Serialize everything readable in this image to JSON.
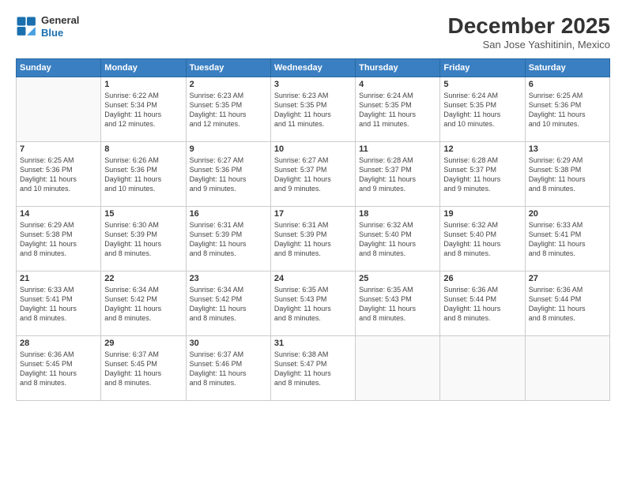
{
  "logo": {
    "line1": "General",
    "line2": "Blue"
  },
  "title": "December 2025",
  "subtitle": "San Jose Yashitinin, Mexico",
  "weekdays": [
    "Sunday",
    "Monday",
    "Tuesday",
    "Wednesday",
    "Thursday",
    "Friday",
    "Saturday"
  ],
  "weeks": [
    [
      {
        "day": "",
        "info": ""
      },
      {
        "day": "1",
        "info": "Sunrise: 6:22 AM\nSunset: 5:34 PM\nDaylight: 11 hours\nand 12 minutes."
      },
      {
        "day": "2",
        "info": "Sunrise: 6:23 AM\nSunset: 5:35 PM\nDaylight: 11 hours\nand 12 minutes."
      },
      {
        "day": "3",
        "info": "Sunrise: 6:23 AM\nSunset: 5:35 PM\nDaylight: 11 hours\nand 11 minutes."
      },
      {
        "day": "4",
        "info": "Sunrise: 6:24 AM\nSunset: 5:35 PM\nDaylight: 11 hours\nand 11 minutes."
      },
      {
        "day": "5",
        "info": "Sunrise: 6:24 AM\nSunset: 5:35 PM\nDaylight: 11 hours\nand 10 minutes."
      },
      {
        "day": "6",
        "info": "Sunrise: 6:25 AM\nSunset: 5:36 PM\nDaylight: 11 hours\nand 10 minutes."
      }
    ],
    [
      {
        "day": "7",
        "info": "Sunrise: 6:25 AM\nSunset: 5:36 PM\nDaylight: 11 hours\nand 10 minutes."
      },
      {
        "day": "8",
        "info": "Sunrise: 6:26 AM\nSunset: 5:36 PM\nDaylight: 11 hours\nand 10 minutes."
      },
      {
        "day": "9",
        "info": "Sunrise: 6:27 AM\nSunset: 5:36 PM\nDaylight: 11 hours\nand 9 minutes."
      },
      {
        "day": "10",
        "info": "Sunrise: 6:27 AM\nSunset: 5:37 PM\nDaylight: 11 hours\nand 9 minutes."
      },
      {
        "day": "11",
        "info": "Sunrise: 6:28 AM\nSunset: 5:37 PM\nDaylight: 11 hours\nand 9 minutes."
      },
      {
        "day": "12",
        "info": "Sunrise: 6:28 AM\nSunset: 5:37 PM\nDaylight: 11 hours\nand 9 minutes."
      },
      {
        "day": "13",
        "info": "Sunrise: 6:29 AM\nSunset: 5:38 PM\nDaylight: 11 hours\nand 8 minutes."
      }
    ],
    [
      {
        "day": "14",
        "info": "Sunrise: 6:29 AM\nSunset: 5:38 PM\nDaylight: 11 hours\nand 8 minutes."
      },
      {
        "day": "15",
        "info": "Sunrise: 6:30 AM\nSunset: 5:39 PM\nDaylight: 11 hours\nand 8 minutes."
      },
      {
        "day": "16",
        "info": "Sunrise: 6:31 AM\nSunset: 5:39 PM\nDaylight: 11 hours\nand 8 minutes."
      },
      {
        "day": "17",
        "info": "Sunrise: 6:31 AM\nSunset: 5:39 PM\nDaylight: 11 hours\nand 8 minutes."
      },
      {
        "day": "18",
        "info": "Sunrise: 6:32 AM\nSunset: 5:40 PM\nDaylight: 11 hours\nand 8 minutes."
      },
      {
        "day": "19",
        "info": "Sunrise: 6:32 AM\nSunset: 5:40 PM\nDaylight: 11 hours\nand 8 minutes."
      },
      {
        "day": "20",
        "info": "Sunrise: 6:33 AM\nSunset: 5:41 PM\nDaylight: 11 hours\nand 8 minutes."
      }
    ],
    [
      {
        "day": "21",
        "info": "Sunrise: 6:33 AM\nSunset: 5:41 PM\nDaylight: 11 hours\nand 8 minutes."
      },
      {
        "day": "22",
        "info": "Sunrise: 6:34 AM\nSunset: 5:42 PM\nDaylight: 11 hours\nand 8 minutes."
      },
      {
        "day": "23",
        "info": "Sunrise: 6:34 AM\nSunset: 5:42 PM\nDaylight: 11 hours\nand 8 minutes."
      },
      {
        "day": "24",
        "info": "Sunrise: 6:35 AM\nSunset: 5:43 PM\nDaylight: 11 hours\nand 8 minutes."
      },
      {
        "day": "25",
        "info": "Sunrise: 6:35 AM\nSunset: 5:43 PM\nDaylight: 11 hours\nand 8 minutes."
      },
      {
        "day": "26",
        "info": "Sunrise: 6:36 AM\nSunset: 5:44 PM\nDaylight: 11 hours\nand 8 minutes."
      },
      {
        "day": "27",
        "info": "Sunrise: 6:36 AM\nSunset: 5:44 PM\nDaylight: 11 hours\nand 8 minutes."
      }
    ],
    [
      {
        "day": "28",
        "info": "Sunrise: 6:36 AM\nSunset: 5:45 PM\nDaylight: 11 hours\nand 8 minutes."
      },
      {
        "day": "29",
        "info": "Sunrise: 6:37 AM\nSunset: 5:45 PM\nDaylight: 11 hours\nand 8 minutes."
      },
      {
        "day": "30",
        "info": "Sunrise: 6:37 AM\nSunset: 5:46 PM\nDaylight: 11 hours\nand 8 minutes."
      },
      {
        "day": "31",
        "info": "Sunrise: 6:38 AM\nSunset: 5:47 PM\nDaylight: 11 hours\nand 8 minutes."
      },
      {
        "day": "",
        "info": ""
      },
      {
        "day": "",
        "info": ""
      },
      {
        "day": "",
        "info": ""
      }
    ]
  ]
}
